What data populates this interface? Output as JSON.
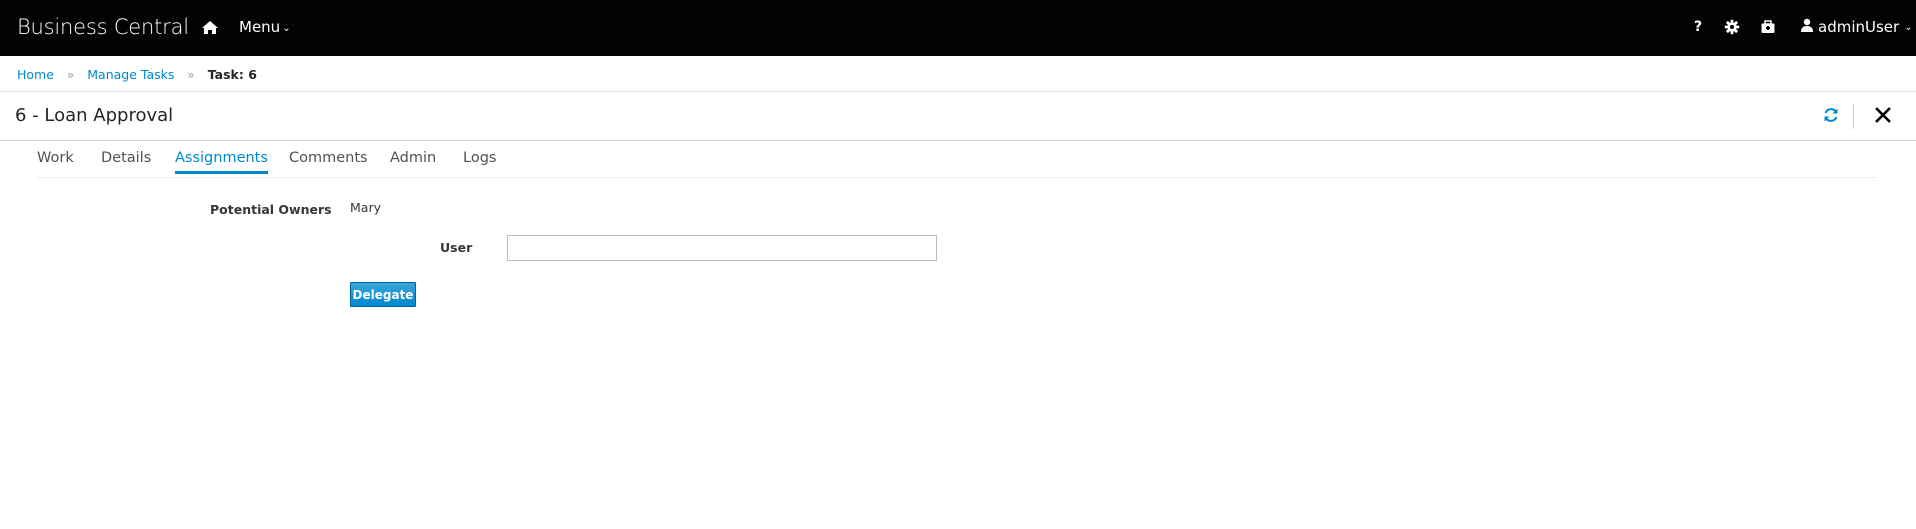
{
  "app": {
    "brand": "Business Central",
    "menu_label": "Menu",
    "help_glyph": "?",
    "user_label": "adminUser",
    "icons": {
      "home": "home-icon",
      "help": "help-icon",
      "settings": "gear-icon",
      "briefcase": "briefcase-icon",
      "user": "user-icon"
    }
  },
  "breadcrumb": {
    "items": [
      "Home",
      "Manage Tasks"
    ],
    "current": "Task: 6",
    "separator": "»"
  },
  "page": {
    "title": "6 - Loan Approval"
  },
  "tabs": [
    {
      "label": "Work",
      "active": false
    },
    {
      "label": "Details",
      "active": false
    },
    {
      "label": "Assignments",
      "active": true
    },
    {
      "label": "Comments",
      "active": false
    },
    {
      "label": "Admin",
      "active": false
    },
    {
      "label": "Logs",
      "active": false
    }
  ],
  "assignments": {
    "potential_owners_label": "Potential Owners",
    "potential_owners_value": "Mary",
    "user_label": "User",
    "user_value": "",
    "user_placeholder": "",
    "delegate_label": "Delegate"
  },
  "colors": {
    "navbar": "#030303",
    "link": "#0088ce",
    "primary_button": "#39a5dc"
  }
}
